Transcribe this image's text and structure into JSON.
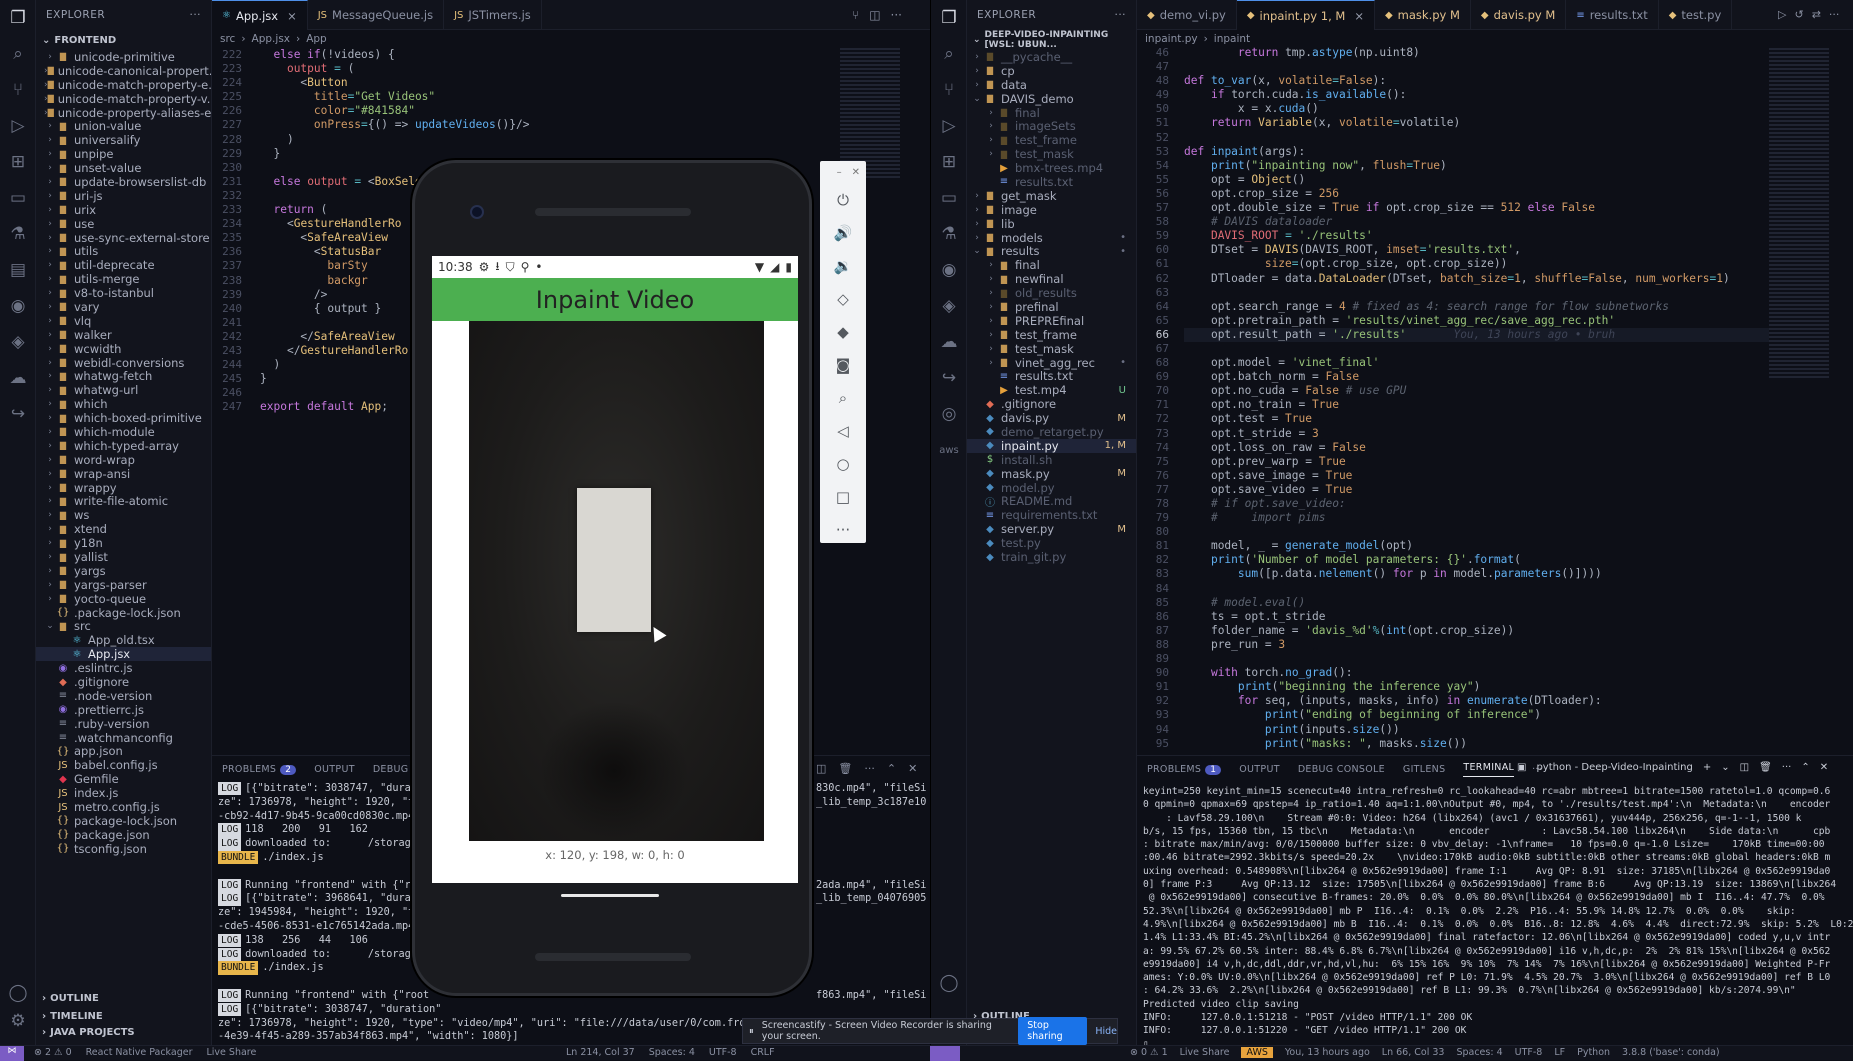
{
  "left": {
    "explorer_title": "EXPLORER",
    "section": "FRONTEND",
    "tree": [
      {
        "label": "unicode-primitive",
        "t": "d"
      },
      {
        "label": "unicode-canonical-propert...",
        "t": "d"
      },
      {
        "label": "unicode-match-property-e...",
        "t": "d"
      },
      {
        "label": "unicode-match-property-v...",
        "t": "d"
      },
      {
        "label": "unicode-property-aliases-e...",
        "t": "d"
      },
      {
        "label": "union-value",
        "t": "d"
      },
      {
        "label": "universalify",
        "t": "d"
      },
      {
        "label": "unpipe",
        "t": "d"
      },
      {
        "label": "unset-value",
        "t": "d"
      },
      {
        "label": "update-browserslist-db",
        "t": "d"
      },
      {
        "label": "uri-js",
        "t": "d"
      },
      {
        "label": "urix",
        "t": "d"
      },
      {
        "label": "use",
        "t": "d"
      },
      {
        "label": "use-sync-external-store",
        "t": "d"
      },
      {
        "label": "utils",
        "t": "d"
      },
      {
        "label": "util-deprecate",
        "t": "d"
      },
      {
        "label": "utils-merge",
        "t": "d"
      },
      {
        "label": "v8-to-istanbul",
        "t": "d"
      },
      {
        "label": "vary",
        "t": "d"
      },
      {
        "label": "vlq",
        "t": "d"
      },
      {
        "label": "walker",
        "t": "d"
      },
      {
        "label": "wcwidth",
        "t": "d"
      },
      {
        "label": "webidl-conversions",
        "t": "d"
      },
      {
        "label": "whatwg-fetch",
        "t": "d"
      },
      {
        "label": "whatwg-url",
        "t": "d"
      },
      {
        "label": "which",
        "t": "d"
      },
      {
        "label": "which-boxed-primitive",
        "t": "d"
      },
      {
        "label": "which-module",
        "t": "d"
      },
      {
        "label": "which-typed-array",
        "t": "d"
      },
      {
        "label": "word-wrap",
        "t": "d"
      },
      {
        "label": "wrap-ansi",
        "t": "d"
      },
      {
        "label": "wrappy",
        "t": "d"
      },
      {
        "label": "write-file-atomic",
        "t": "d"
      },
      {
        "label": "ws",
        "t": "d"
      },
      {
        "label": "xtend",
        "t": "d"
      },
      {
        "label": "y18n",
        "t": "d"
      },
      {
        "label": "yallist",
        "t": "d"
      },
      {
        "label": "yargs",
        "t": "d"
      },
      {
        "label": "yargs-parser",
        "t": "d"
      },
      {
        "label": "yocto-queue",
        "t": "d"
      },
      {
        "label": ".package-lock.json",
        "t": "j"
      },
      {
        "label": "src",
        "t": "o"
      },
      {
        "label": "App_old.tsx",
        "t": "ts",
        "i": 2
      },
      {
        "label": "App.jsx",
        "t": "ts",
        "i": 2,
        "sel": true
      },
      {
        "label": ".eslintrc.js",
        "t": "es"
      },
      {
        "label": ".gitignore",
        "t": "git"
      },
      {
        "label": ".node-version",
        "t": "f"
      },
      {
        "label": ".prettierrc.js",
        "t": "es"
      },
      {
        "label": ".ruby-version",
        "t": "f"
      },
      {
        "label": ".watchmanconfig",
        "t": "f"
      },
      {
        "label": "app.json",
        "t": "j"
      },
      {
        "label": "babel.config.js",
        "t": "js"
      },
      {
        "label": "Gemfile",
        "t": "rb"
      },
      {
        "label": "index.js",
        "t": "js"
      },
      {
        "label": "metro.config.js",
        "t": "js"
      },
      {
        "label": "package-lock.json",
        "t": "j"
      },
      {
        "label": "package.json",
        "t": "j"
      },
      {
        "label": "tsconfig.json",
        "t": "j"
      }
    ],
    "bottom_sections": [
      "OUTLINE",
      "TIMELINE",
      "JAVA PROJECTS"
    ],
    "tabs": [
      {
        "label": "App.jsx",
        "active": true,
        "close": "×"
      },
      {
        "label": "MessageQueue.js",
        "active": false
      },
      {
        "label": "JSTimers.js",
        "active": false
      }
    ],
    "breadcrumb": [
      "src",
      "App.jsx",
      "App"
    ],
    "line_numbers": [
      "222",
      "223",
      "224",
      "225",
      "226",
      "227",
      "228",
      "229",
      "230",
      "231",
      "232",
      "233",
      "234",
      "235",
      "236",
      "237",
      "238",
      "239",
      "240",
      "241",
      "242",
      "243",
      "244",
      "245",
      "246",
      "247"
    ],
    "panel_tabs": [
      "PROBLEMS",
      "OUTPUT",
      "DEBUG CONSOLE"
    ],
    "problems_count": "2",
    "terminal": [
      {
        "tag": "LOG",
        "text": "[{\"bitrate\": 3038747, \"duratio"
      },
      {
        "tag": "",
        "text": "ze\": 1736978, \"height\": 1920, \"type\""
      },
      {
        "tag": "",
        "text": "-cb92-4d17-9b45-9ca00cd0830c.mp4\", \""
      },
      {
        "tag": "LOG",
        "text": "118   200   91   162"
      },
      {
        "tag": "LOG",
        "text": "downloaded to:      /storage/emula"
      },
      {
        "tag": "BUNDLE",
        "text": "./index.js"
      },
      {
        "tag": "",
        "text": ""
      },
      {
        "tag": "LOG",
        "text": "Running \"frontend\" with {\"root"
      },
      {
        "tag": "LOG",
        "text": "[{\"bitrate\": 3968641, \"duratio"
      },
      {
        "tag": "",
        "text": "ze\": 1945984, \"height\": 1920, \"type\""
      },
      {
        "tag": "",
        "text": "-cde5-4506-8531-e1c76514​2ada.mp4\","
      },
      {
        "tag": "LOG",
        "text": "138   256   44   106"
      },
      {
        "tag": "LOG",
        "text": "downloaded to:      /storage/emula"
      },
      {
        "tag": "BUNDLE",
        "text": "./index.js"
      },
      {
        "tag": "",
        "text": ""
      },
      {
        "tag": "LOG",
        "text": "Running \"frontend\" with {\"root"
      },
      {
        "tag": "LOG",
        "text": "[{\"bitrate\": 3038747, \"duration\""
      },
      {
        "tag": "",
        "text": "ze\": 1736978, \"height\": 1920, \"type\": \"video/mp4\", \"uri\": \"file:///data/user/0/com.frontend/cache/rn_image_picker_lib_temp_bf02c5ad"
      },
      {
        "tag": "",
        "text": "-4e39-4f45-a289-357ab34f863.mp4\", \"width\": 1080}]"
      }
    ],
    "terminal_right": [
      "830c.mp4\", \"fileSi",
      "_lib_temp_3c187e10",
      "",
      "",
      "",
      "",
      "",
      "2ada.mp4\", \"fileSi",
      "_lib_temp_04076905",
      "",
      "",
      "",
      "",
      "",
      "",
      "f863.mp4\", \"fileSi"
    ]
  },
  "phone": {
    "time": "10:38",
    "app_title": "Inpaint Video",
    "coords": "x: 120, y: 198, w: 0, h: 0",
    "header_color": "#4caf50"
  },
  "emulator_toolbar": [
    "power-icon",
    "volume-up-icon",
    "volume-down-icon",
    "rotate-left-icon",
    "rotate-right-icon",
    "camera-icon",
    "zoom-icon",
    "back-icon",
    "home-icon",
    "overview-icon",
    "more-icon"
  ],
  "right": {
    "explorer_title": "EXPLORER",
    "section": "DEEP-VIDEO-INPAINTING [WSL: UBUN...",
    "tree": [
      {
        "label": "__pycache__",
        "t": "d",
        "dim": true
      },
      {
        "label": "cp",
        "t": "d"
      },
      {
        "label": "data",
        "t": "d"
      },
      {
        "label": "DAVIS_demo",
        "t": "o"
      },
      {
        "label": "final",
        "t": "d",
        "in": 1,
        "dim": true
      },
      {
        "label": "imageSets",
        "t": "d",
        "in": 1,
        "dim": true
      },
      {
        "label": "test_frame",
        "t": "d",
        "in": 1,
        "dim": true
      },
      {
        "label": "test_mask",
        "t": "d",
        "in": 1,
        "dim": true
      },
      {
        "label": "bmx-trees.mp4",
        "t": "mp4",
        "in": 1,
        "dim": true
      },
      {
        "label": "results.txt",
        "t": "txt",
        "in": 1,
        "dim": true
      },
      {
        "label": "get_mask",
        "t": "d"
      },
      {
        "label": "image",
        "t": "d"
      },
      {
        "label": "lib",
        "t": "d"
      },
      {
        "label": "models",
        "t": "d",
        "badge": "•"
      },
      {
        "label": "results",
        "t": "o",
        "badge": "•"
      },
      {
        "label": "final",
        "t": "d",
        "in": 1
      },
      {
        "label": "newfinal",
        "t": "d",
        "in": 1
      },
      {
        "label": "old_results",
        "t": "d",
        "in": 1,
        "dim": true
      },
      {
        "label": "prefinal",
        "t": "d",
        "in": 1
      },
      {
        "label": "PREPREfinal",
        "t": "d",
        "in": 1
      },
      {
        "label": "test_frame",
        "t": "d",
        "in": 1
      },
      {
        "label": "test_mask",
        "t": "d",
        "in": 1
      },
      {
        "label": "vinet_agg_rec",
        "t": "d",
        "in": 1,
        "badge": "•"
      },
      {
        "label": "results.txt",
        "t": "txt",
        "in": 1
      },
      {
        "label": "test.mp4",
        "t": "mp4",
        "in": 1,
        "badge": "U"
      },
      {
        "label": ".gitignore",
        "t": "git"
      },
      {
        "label": "davis.py",
        "t": "py",
        "badge": "M"
      },
      {
        "label": "demo_retarget.py",
        "t": "py",
        "dim": true
      },
      {
        "label": "inpaint.py",
        "t": "py",
        "badge": "1, M",
        "sel": true
      },
      {
        "label": "install.sh",
        "t": "sh",
        "dim": true
      },
      {
        "label": "mask.py",
        "t": "py",
        "badge": "M"
      },
      {
        "label": "model.py",
        "t": "py",
        "dim": true
      },
      {
        "label": "README.md",
        "t": "md",
        "dim": true
      },
      {
        "label": "requirements.txt",
        "t": "txt",
        "dim": true
      },
      {
        "label": "server.py",
        "t": "py",
        "badge": "M"
      },
      {
        "label": "test.py",
        "t": "py",
        "dim": true
      },
      {
        "label": "train_git.py",
        "t": "py",
        "dim": true
      }
    ],
    "bottom_section": "OUTLINE",
    "tabs": [
      {
        "label": "demo_vi.py",
        "active": false
      },
      {
        "label": "inpaint.py 1, M",
        "active": true,
        "close": "×"
      },
      {
        "label": "mask.py M",
        "active": false
      },
      {
        "label": "davis.py M",
        "active": false
      },
      {
        "label": "results.txt",
        "active": false
      },
      {
        "label": "test.py",
        "active": false
      }
    ],
    "breadcrumb": [
      "inpaint.py",
      "inpaint"
    ],
    "line_numbers": [
      "46",
      "47",
      "48",
      "49",
      "50",
      "51",
      "52",
      "53",
      "54",
      "55",
      "56",
      "57",
      "58",
      "59",
      "60",
      "61",
      "62",
      "63",
      "64",
      "65",
      "66",
      "67",
      "68",
      "69",
      "70",
      "71",
      "72",
      "73",
      "74",
      "75",
      "76",
      "77",
      "78",
      "79",
      "80",
      "81",
      "82",
      "83",
      "84",
      "85",
      "86",
      "87",
      "88",
      "89",
      "90",
      "91",
      "92",
      "93",
      "94",
      "95"
    ],
    "active_line": "66",
    "blame": "You, 13 hours ago • bruh",
    "panel_tabs": [
      "PROBLEMS",
      "OUTPUT",
      "DEBUG CONSOLE",
      "GITLENS",
      "TERMINAL"
    ],
    "problems_count": "1",
    "terminal_title": "python - Deep-Video-Inpainting",
    "terminal": [
      "keyint=250 keyint_min=15 scenecut=40 intra_refresh=0 rc_lookahead=40 rc=abr mbtree=1 bitrate=1500 ratetol=1.0 qcomp=0.6",
      "0 qpmin=0 qpmax=69 qpstep=4 ip_ratio=1.40 aq=1:1.00\\nOutput #0, mp4, to './results/test.mp4':\\n  Metadata:\\n    encoder",
      "    : Lavf58.29.100\\n    Stream #0:0: Video: h264 (libx264) (avc1 / 0x31637661), yuv444p, 256x256, q=-1--1, 1500 k",
      "b/s, 15 fps, 15360 tbn, 15 tbc\\n    Metadata:\\n      encoder         : Lavc58.54.100 libx264\\n    Side data:\\n      cpb",
      ": bitrate max/min/avg: 0/0/1500000 buffer size: 0 vbv_delay: -1\\nframe=   10 fps=0.0 q=-1.0 Lsize=    170kB time=00:00",
      ":00.46 bitrate=2992.3kbits/s speed=20.2x    \\nvideo:170kB audio:0kB subtitle:0kB other streams:0kB global headers:0kB m",
      "uxing overhead: 0.548908%\\n[libx264 @ 0x562e9919da00] frame I:1     Avg QP: 8.91  size: 37185\\n[libx264 @ 0x562e9919da0",
      "0] frame P:3     Avg QP:13.12  size: 17505\\n[libx264 @ 0x562e9919da00] frame B:6     Avg QP:13.19  size: 13869\\n[libx264",
      " @ 0x562e9919da00] consecutive B-frames: 20.0%  0.0%  0.0% 80.0%\\n[libx264 @ 0x562e9919da00] mb I  I16..4: 47.7%  0.0%",
      "52.3%\\n[libx264 @ 0x562e9919da00] mb P  I16..4:  0.1%  0.0%  2.2%  P16..4: 55.9% 14.8% 12.7%  0.0%  0.0%    skip:",
      "4.9%\\n[libx264 @ 0x562e9919da00] mb B  I16..4:  0.1%  0.0%  0.0%  B16..8: 12.8%  4.6%  4.4%  direct:72.9%  skip: 5.2%  L0:2",
      "1.4% L1:33.4% BI:45.2%\\n[libx264 @ 0x562e9919da00] final ratefactor: 12.06\\n[libx264 @ 0x562e9919da00] coded y,u,v intr",
      "a: 99.5% 67.2% 60.5% inter: 88.4% 6.8% 6.7%\\n[libx264 @ 0x562e9919da00] i16 v,h,dc,p:  2%  2% 81% 15%\\n[libx264 @ 0x562",
      "e9919da00] i4 v,h,dc,ddl,ddr,vr,hd,vl,hu:  6% 15% 16%  9% 10%  7% 14%  7% 16%\\n[libx264 @ 0x562e9919da00] Weighted P-Fr",
      "ames: Y:0.0% UV:0.0%\\n[libx264 @ 0x562e9919da00] ref P L0: 71.9%  4.5% 20.7%  3.0%\\n[libx264 @ 0x562e9919da00] ref B L0",
      ": 64.2% 33.6%  2.2%\\n[libx264 @ 0x562e9919da00] ref B L1: 99.3%  0.7%\\n[libx264 @ 0x562e9919da00] kb/s:2074.99\\n\"",
      "Predicted video clip saving",
      "INFO:     127.0.0.1:51218 - \"POST /video HTTP/1.1\" 200 OK",
      "INFO:     127.0.0.1:51220 - \"GET /video HTTP/1.1\" 200 OK"
    ]
  },
  "share_bar": {
    "text": "Screencastify - Screen Video Recorder is sharing your screen.",
    "stop": "Stop sharing",
    "hide": "Hide"
  },
  "status_left": [
    "⊗ 2 ⚠ 0",
    "React Native Packager",
    "Live Share"
  ],
  "status_mid": [
    "Ln 214, Col 37",
    "Spaces: 4",
    "UTF-8",
    "CRLF"
  ],
  "status_right": [
    "⊗ 0 ⚠ 1",
    "Live Share",
    "AWS",
    "You, 13 hours ago",
    "Ln 66, Col 33",
    "Spaces: 4",
    "UTF-8",
    "LF",
    "Python",
    "3.8.8 ('base': conda)"
  ]
}
